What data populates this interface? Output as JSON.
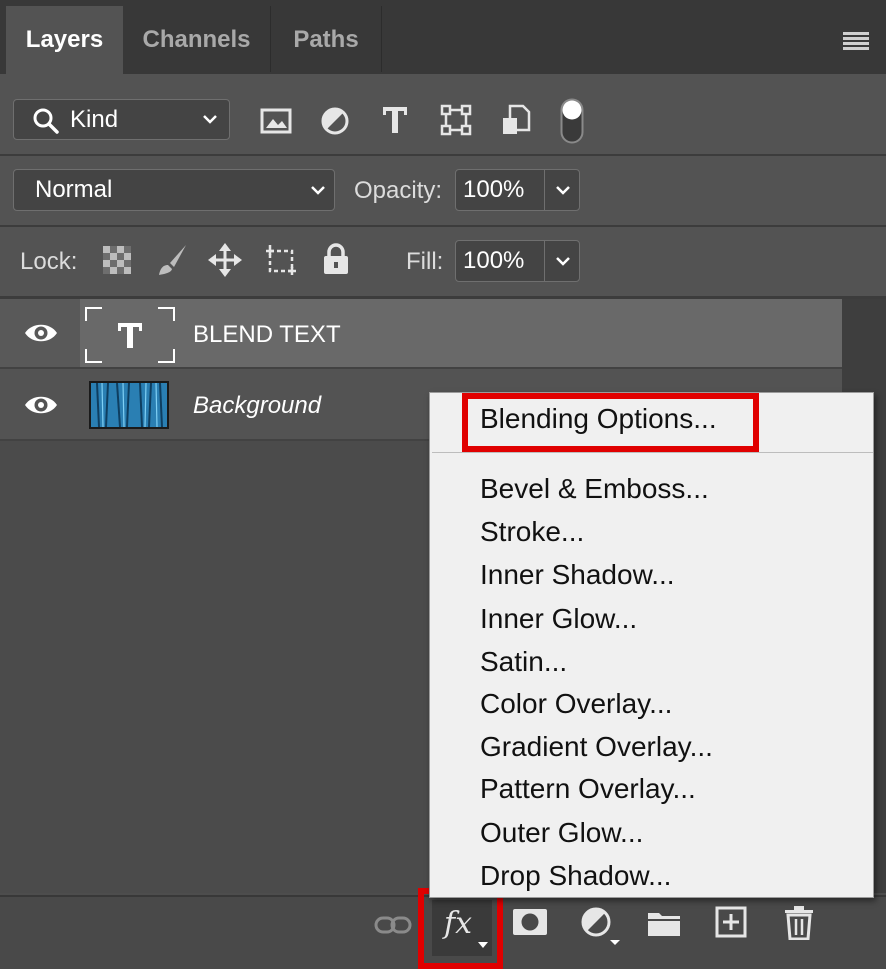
{
  "tabs": [
    {
      "label": "Layers"
    },
    {
      "label": "Channels"
    },
    {
      "label": "Paths"
    }
  ],
  "filter": {
    "kind_label": "Kind"
  },
  "blend": {
    "mode": "Normal",
    "opacity_label": "Opacity:",
    "opacity_value": "100%"
  },
  "lock": {
    "label": "Lock:",
    "fill_label": "Fill:",
    "fill_value": "100%"
  },
  "layers": [
    {
      "name": "BLEND TEXT",
      "type": "text",
      "visible": true,
      "selected": true
    },
    {
      "name": "Background",
      "type": "image",
      "visible": true,
      "selected": false
    }
  ],
  "fx_menu": {
    "items": [
      {
        "label": "Blending Options..."
      },
      {
        "label": "Bevel & Emboss..."
      },
      {
        "label": "Stroke..."
      },
      {
        "label": "Inner Shadow..."
      },
      {
        "label": "Inner Glow..."
      },
      {
        "label": "Satin..."
      },
      {
        "label": "Color Overlay..."
      },
      {
        "label": "Gradient Overlay..."
      },
      {
        "label": "Pattern Overlay..."
      },
      {
        "label": "Outer Glow..."
      },
      {
        "label": "Drop Shadow..."
      }
    ]
  },
  "bottom": {
    "fx_label": "fx"
  },
  "icons": [
    "search-icon",
    "image-filter-icon",
    "adjustment-filter-icon",
    "type-filter-icon",
    "shape-filter-icon",
    "smart-object-filter-icon",
    "filter-toggle-icon",
    "lock-transparent-icon",
    "lock-image-icon",
    "lock-position-icon",
    "lock-artboard-icon",
    "lock-all-icon",
    "eye-icon",
    "link-icon",
    "fx-icon",
    "mask-icon",
    "adjustment-layer-icon",
    "folder-icon",
    "new-layer-icon",
    "trash-icon",
    "panel-menu-icon"
  ],
  "colors": {
    "highlight": "#e00000",
    "panel_bg": "#4d4d4d",
    "menu_bg": "#f0f0f0",
    "selected_layer": "#696969"
  }
}
